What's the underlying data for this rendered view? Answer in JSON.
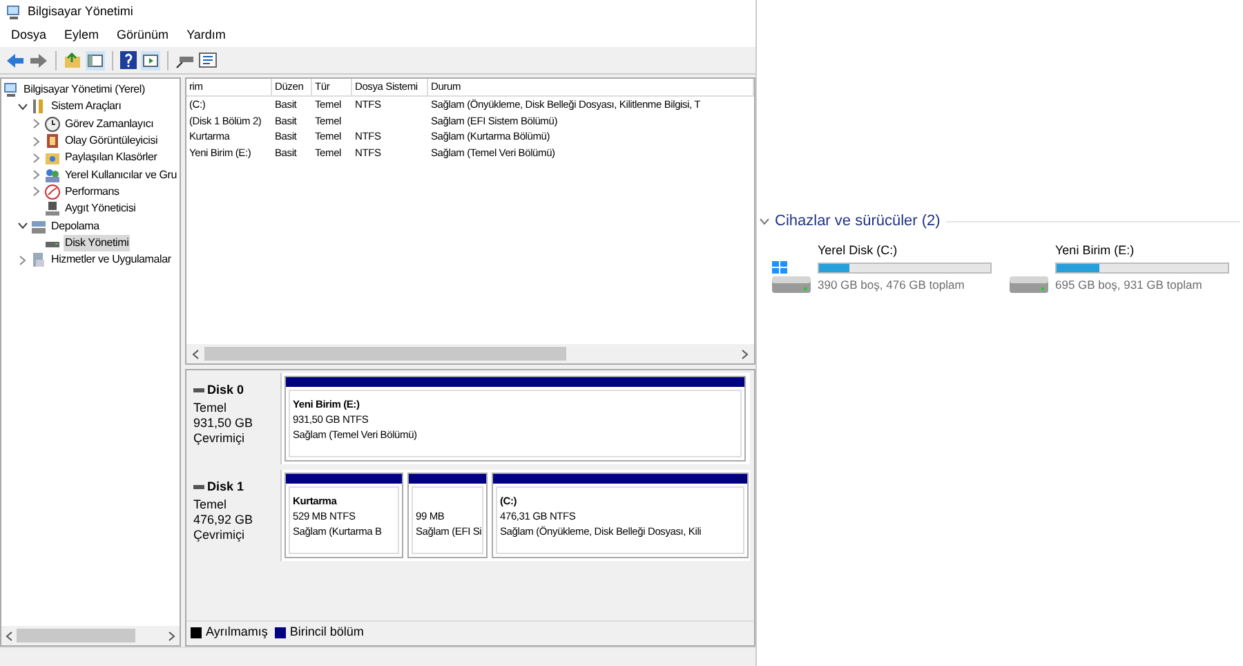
{
  "window": {
    "title": "Bilgisayar Yönetimi"
  },
  "menu": [
    "Dosya",
    "Eylem",
    "Görünüm",
    "Yardım"
  ],
  "tree": [
    {
      "label": "Bilgisayar Yönetimi (Yerel)",
      "selected": false,
      "children": [
        {
          "label": "Sistem Araçları",
          "expanded": true,
          "selected": false,
          "children": [
            {
              "label": "Görev Zamanlayıcı",
              "expanded": false,
              "selected": false
            },
            {
              "label": "Olay Görüntüleyicisi",
              "expanded": false,
              "selected": false
            },
            {
              "label": "Paylaşılan Klasörler",
              "expanded": false,
              "selected": false
            },
            {
              "label": "Yerel Kullanıcılar ve Gru",
              "expanded": false,
              "selected": false
            },
            {
              "label": "Performans",
              "expanded": false,
              "selected": false
            },
            {
              "label": "Aygıt Yöneticisi",
              "selected": false
            }
          ]
        },
        {
          "label": "Depolama",
          "expanded": true,
          "selected": false,
          "children": [
            {
              "label": "Disk Yönetimi",
              "selected": true
            }
          ]
        },
        {
          "label": "Hizmetler ve Uygulamalar",
          "expanded": false,
          "selected": false
        }
      ]
    }
  ],
  "table": {
    "columns": [
      "rim",
      "Düzen",
      "Tür",
      "Dosya Sistemi",
      "Durum"
    ],
    "rows": [
      [
        "(C:)",
        "Basit",
        "Temel",
        "NTFS",
        "Sağlam (Önyükleme, Disk Belleği Dosyası, Kilitlenme Bilgisi, T"
      ],
      [
        "(Disk 1 Bölüm 2)",
        "Basit",
        "Temel",
        "",
        "Sağlam (EFI Sistem Bölümü)"
      ],
      [
        "Kurtarma",
        "Basit",
        "Temel",
        "NTFS",
        "Sağlam (Kurtarma Bölümü)"
      ],
      [
        "Yeni Birim (E:)",
        "Basit",
        "Temel",
        "NTFS",
        "Sağlam (Temel Veri Bölümü)"
      ]
    ]
  },
  "disks": [
    {
      "name": "Disk 0",
      "type": "Temel",
      "size": "931,50 GB",
      "status": "Çevrimiçi",
      "partitions": [
        {
          "title": "Yeni Birim  (E:)",
          "size": "931,50 GB NTFS",
          "status": "Sağlam (Temel Veri Bölümü)"
        }
      ]
    },
    {
      "name": "Disk 1",
      "type": "Temel",
      "size": "476,92 GB",
      "status": "Çevrimiçi",
      "partitions": [
        {
          "title": "Kurtarma",
          "size": "529 MB NTFS",
          "status": "Sağlam (Kurtarma B"
        },
        {
          "size": "99 MB",
          "status": "Sağlam (EFI Si"
        },
        {
          "title": " (C:)",
          "size": "476,31 GB NTFS",
          "status": "Sağlam (Önyükleme, Disk Belleği Dosyası, Kili"
        }
      ]
    }
  ],
  "legend": [
    {
      "label": "Ayrılmamış",
      "color": "#000000"
    },
    {
      "label": "Birincil bölüm",
      "color": "#000080"
    }
  ],
  "explorer": {
    "group": "Cihazlar ve sürücüler (2)",
    "expanded": true,
    "drives": [
      {
        "kind": "system",
        "name": "Yerel Disk (C:)",
        "level": 0.18,
        "info": "390 GB boş, 476 GB toplam"
      },
      {
        "kind": "plain",
        "name": "Yeni Birim (E:)",
        "level": 0.25,
        "info": "695 GB boş, 931 GB toplam"
      }
    ]
  }
}
